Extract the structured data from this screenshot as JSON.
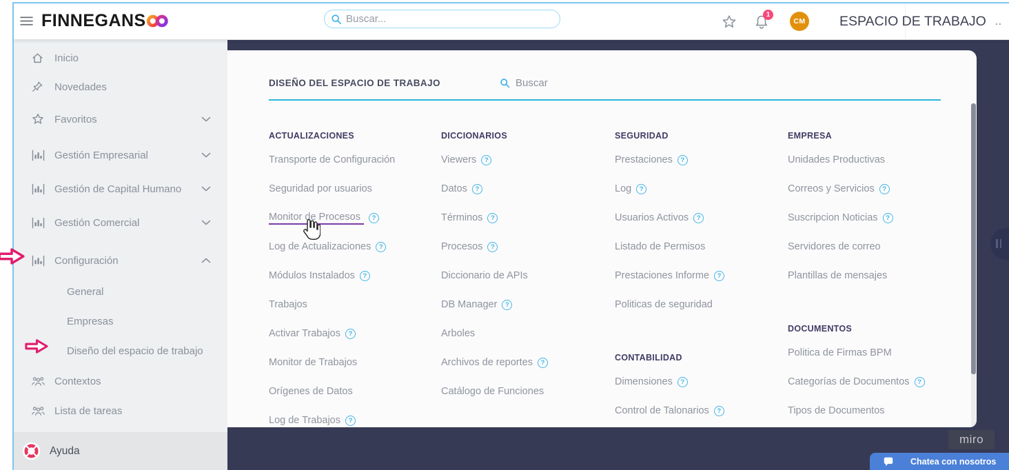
{
  "topbar": {
    "logo_text": "FINNEGANS",
    "search_placeholder": "Buscar...",
    "notification_count": "1",
    "avatar_initials": "CM",
    "workspace_title": "ESPACIO DE TRABAJO",
    "overflow_dots": ".."
  },
  "sidebar": {
    "items": [
      {
        "label": "Inicio",
        "icon": "home"
      },
      {
        "label": "Novedades",
        "icon": "pin"
      },
      {
        "label": "Favoritos",
        "icon": "star",
        "chevron": "down"
      },
      {
        "label": "Gestión Empresarial",
        "icon": "chart",
        "chevron": "down"
      },
      {
        "label": "Gestión de Capital Humano",
        "icon": "chart",
        "chevron": "down"
      },
      {
        "label": "Gestión Comercial",
        "icon": "chart",
        "chevron": "down"
      },
      {
        "label": "Configuración",
        "icon": "chart",
        "chevron": "up",
        "annotated": true
      },
      {
        "label": "General",
        "sub": true
      },
      {
        "label": "Empresas",
        "sub": true
      },
      {
        "label": "Diseño del espacio de trabajo",
        "sub": true,
        "annotated": true
      },
      {
        "label": "Contextos",
        "icon": "people"
      },
      {
        "label": "Lista de tareas",
        "icon": "people"
      }
    ],
    "footer": {
      "label": "Ayuda"
    }
  },
  "panel": {
    "title": "DISEÑO DEL ESPACIO DE TRABAJO",
    "search_label": "Buscar",
    "columns": [
      {
        "sections": [
          {
            "header": "ACTUALIZACIONES",
            "items": [
              {
                "label": "Transporte de Configuración"
              },
              {
                "label": "Seguridad por usuarios"
              },
              {
                "label": "Monitor de Procesos",
                "help": true,
                "underlined": true,
                "cursor": true
              },
              {
                "label": "Log de Actualizaciones",
                "help": true
              },
              {
                "label": "Módulos Instalados",
                "help": true
              },
              {
                "label": "Trabajos"
              },
              {
                "label": "Activar Trabajos",
                "help": true
              },
              {
                "label": "Monitor de Trabajos"
              },
              {
                "label": "Orígenes de Datos"
              },
              {
                "label": "Log de Trabajos",
                "help": true
              }
            ]
          }
        ]
      },
      {
        "sections": [
          {
            "header": "DICCIONARIOS",
            "items": [
              {
                "label": "Viewers",
                "help": true
              },
              {
                "label": "Datos",
                "help": true
              },
              {
                "label": "Términos",
                "help": true
              },
              {
                "label": "Procesos",
                "help": true
              },
              {
                "label": "Diccionario de APIs"
              },
              {
                "label": "DB Manager",
                "help": true
              },
              {
                "label": "Arboles"
              },
              {
                "label": "Archivos de reportes",
                "help": true
              },
              {
                "label": "Catálogo de Funciones"
              }
            ]
          }
        ]
      },
      {
        "sections": [
          {
            "header": "SEGURIDAD",
            "items": [
              {
                "label": "Prestaciones",
                "help": true
              },
              {
                "label": "Log",
                "help": true
              },
              {
                "label": "Usuarios Activos",
                "help": true
              },
              {
                "label": "Listado de Permisos"
              },
              {
                "label": "Prestaciones Informe",
                "help": true
              },
              {
                "label": "Politicas de seguridad"
              }
            ]
          },
          {
            "header": "CONTABILIDAD",
            "items": [
              {
                "label": "Dimensiones",
                "help": true
              },
              {
                "label": "Control de Talonarios",
                "help": true
              }
            ]
          }
        ]
      },
      {
        "sections": [
          {
            "header": "EMPRESA",
            "items": [
              {
                "label": "Unidades Productivas"
              },
              {
                "label": "Correos y Servicios",
                "help": true
              },
              {
                "label": "Suscripcion Noticias",
                "help": true
              },
              {
                "label": "Servidores de correo"
              },
              {
                "label": "Plantillas de mensajes"
              }
            ]
          },
          {
            "header": "DOCUMENTOS",
            "items": [
              {
                "label": "Politica de Firmas BPM"
              },
              {
                "label": "Categorías de Documentos",
                "help": true
              },
              {
                "label": "Tipos de Documentos"
              }
            ]
          }
        ]
      }
    ]
  },
  "overlays": {
    "miro_label": "miro",
    "chat_label": "Chatea con nosotros"
  },
  "colors": {
    "navy_bg": "#363a54",
    "accent_blue": "#45b6e7",
    "cyan_line": "#2cb7da",
    "annotation_pink": "#e11d6e",
    "underline_purple": "#7d3aa5",
    "badge_pink": "#f8487b",
    "avatar_orange": "#e2900c",
    "chat_blue": "#4b80d8"
  }
}
